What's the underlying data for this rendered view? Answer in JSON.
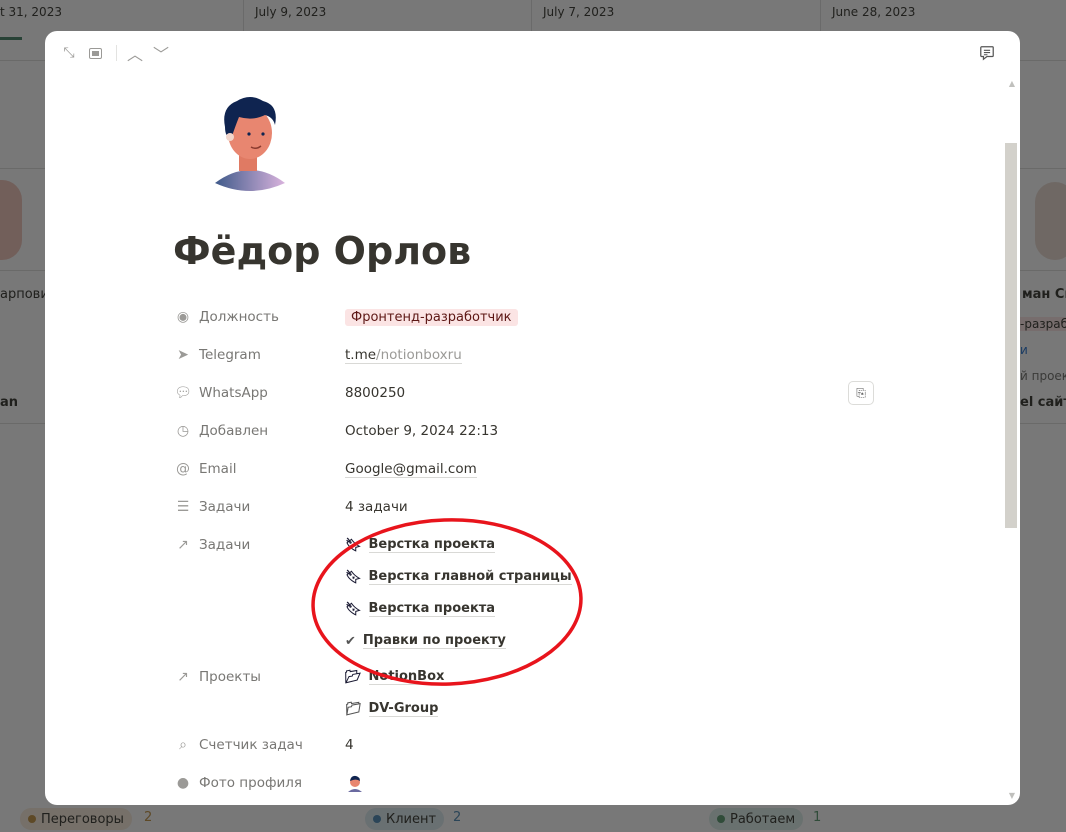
{
  "background": {
    "dates": [
      "t 31, 2023",
      "July 9, 2023",
      "July 7, 2023",
      "June 28, 2023"
    ],
    "left_card": {
      "name": "арпови",
      "link": "an"
    },
    "right_card": {
      "name": "ман Ск",
      "tag": "-разраб",
      "line1": "и",
      "line2": "й проект",
      "link": "el сайт"
    },
    "groups": [
      {
        "label": "Переговоры",
        "count": "2",
        "color": "#c29343"
      },
      {
        "label": "Клиент",
        "count": "2",
        "color": "#4f8bb4"
      },
      {
        "label": "Работаем",
        "count": "1",
        "color": "#5b9a6e"
      }
    ]
  },
  "modal": {
    "title": "Фёдор Орлов",
    "properties": {
      "position": {
        "label": "Должность",
        "value": "Фронтенд-разработчик",
        "icon": "select-icon"
      },
      "telegram": {
        "label": "Telegram",
        "host": "t.me",
        "path": "/notionboxru",
        "icon": "paper-plane-icon"
      },
      "whatsapp": {
        "label": "WhatsApp",
        "value": "8800250",
        "icon": "chat-bubble-icon"
      },
      "added": {
        "label": "Добавлен",
        "value": "October 9, 2024 22:13",
        "icon": "clock-icon"
      },
      "email": {
        "label": "Email",
        "value": "Google@gmail.com",
        "icon": "at-icon"
      },
      "tasks_count": {
        "label": "Задачи",
        "value": "4 задачи",
        "icon": "checklist-icon"
      },
      "tasks": {
        "label": "Задачи",
        "icon": "relation-arrow-icon",
        "items": [
          {
            "text": "Верстка проекта",
            "icon": "bookmark-icon"
          },
          {
            "text": "Верстка главной страницы",
            "icon": "bookmark-icon"
          },
          {
            "text": "Верстка проекта",
            "icon": "bookmark-icon"
          },
          {
            "text": "Правки по проекту",
            "icon": "check-circle-icon"
          }
        ]
      },
      "projects": {
        "label": "Проекты",
        "icon": "relation-arrow-icon",
        "items": [
          {
            "text": "NotionBox",
            "icon": "folder-open-icon"
          },
          {
            "text": "DV-Group",
            "icon": "folder-icon"
          }
        ]
      },
      "counter": {
        "label": "Счетчик задач",
        "value": "4",
        "icon": "search-icon"
      },
      "photo": {
        "label": "Фото профиля",
        "icon": "person-icon"
      }
    }
  },
  "annotation": {
    "color": "#e8141c",
    "shape": "ellipse"
  }
}
